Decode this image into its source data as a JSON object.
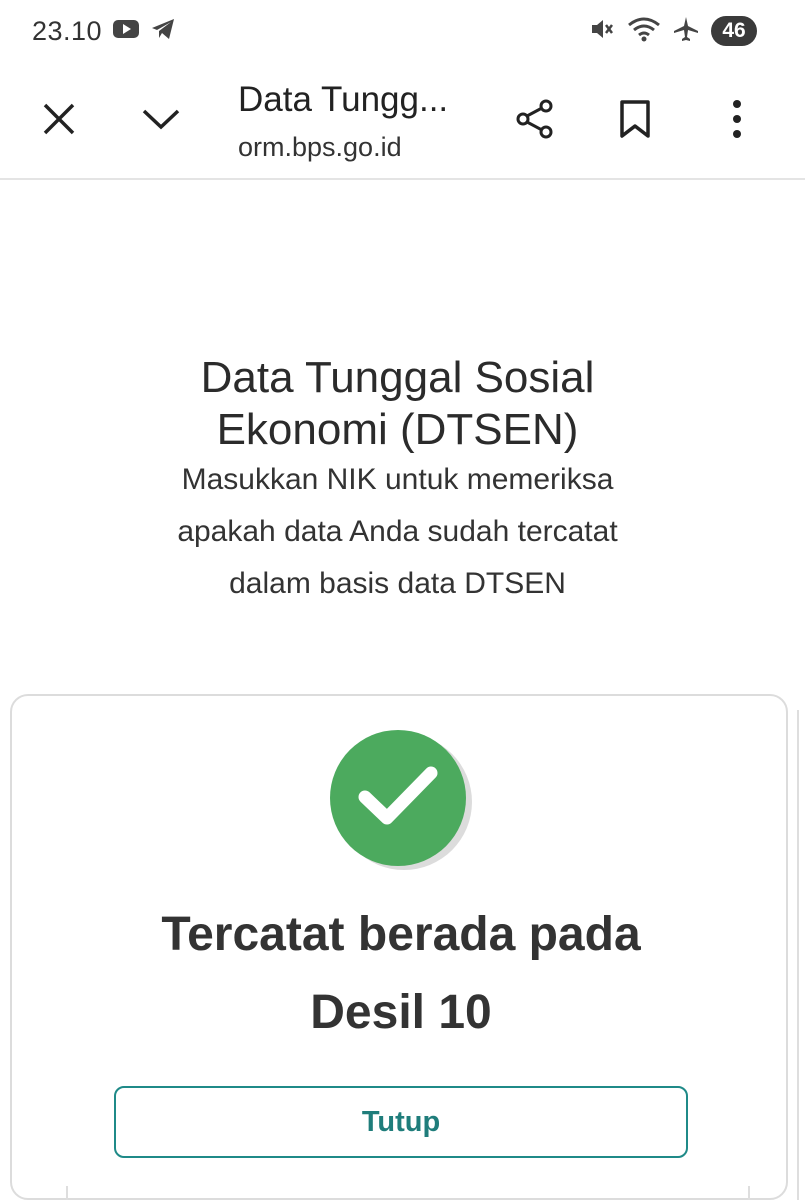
{
  "status_bar": {
    "time": "23.10",
    "battery": "46"
  },
  "toolbar": {
    "title": "Data Tungg...",
    "url": "orm.bps.go.id"
  },
  "page": {
    "title_line1": "Data Tunggal Sosial",
    "title_line2": "Ekonomi (DTSEN)",
    "subtitle_line1": "Masukkan NIK untuk memeriksa",
    "subtitle_line2": "apakah data Anda sudah tercatat",
    "subtitle_line3": "dalam basis data DTSEN"
  },
  "result_card": {
    "line1": "Tercatat berada pada",
    "line2": "Desil 10",
    "close_label": "Tutup"
  },
  "colors": {
    "success": "#4caa5e",
    "accent": "#1f8a88"
  }
}
